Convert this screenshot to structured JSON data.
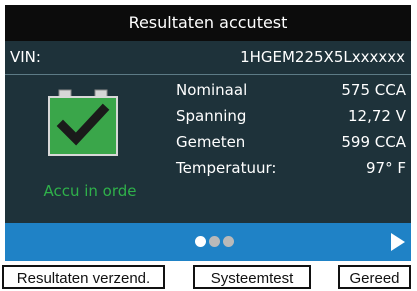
{
  "header": {
    "title": "Resultaten accutest"
  },
  "vin": {
    "label": "VIN:",
    "value": "1HGEM225X5Lxxxxxx"
  },
  "status": {
    "label": "Accu in orde",
    "icon": "battery-check-icon",
    "color": "#2fb14a"
  },
  "metrics": [
    {
      "label": "Nominaal",
      "value": "575 CCA"
    },
    {
      "label": "Spanning",
      "value": "12,72 V"
    },
    {
      "label": "Gemeten",
      "value": "599 CCA"
    },
    {
      "label": "Temperatuur:",
      "value": "97° F"
    }
  ],
  "pager": {
    "total_pages": 3,
    "current_page": 1
  },
  "softkeys": {
    "send_label": "Resultaten verzend.",
    "system_label": "Systeemtest",
    "done_label": "Gereed"
  },
  "colors": {
    "title_bg": "#0c0c0c",
    "panel_bg": "#1e323a",
    "nav_bar": "#1f82c6",
    "ok_green": "#2fb14a"
  }
}
